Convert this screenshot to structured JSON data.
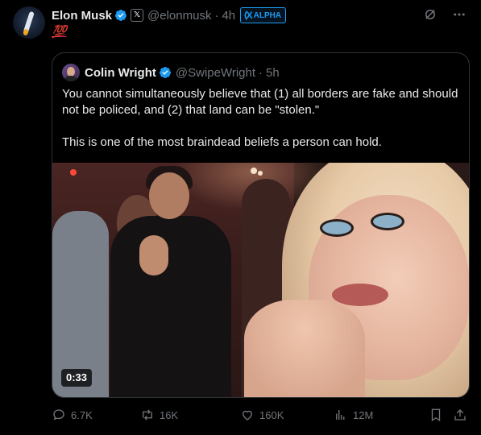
{
  "author": {
    "name": "Elon Musk",
    "handle": "@elonmusk",
    "time": "4h",
    "badge_label": "ALPHA",
    "badge_icon": "x-alpha-icon",
    "x_affiliation": "𝕏"
  },
  "tweet": {
    "text": "💯"
  },
  "quoted": {
    "name": "Colin Wright",
    "handle": "@SwipeWright",
    "time": "5h",
    "paragraphs": [
      "You cannot simultaneously believe that (1) all borders are fake and should not be policed, and (2) that land can be \"stolen.\"",
      "This is one of the most braindead beliefs a person can hold."
    ],
    "media": {
      "type": "video",
      "duration": "0:33"
    }
  },
  "actions": {
    "replies": "6.7K",
    "reposts": "16K",
    "likes": "160K",
    "views": "12M"
  },
  "colors": {
    "background": "#000000",
    "text": "#e7e9ea",
    "secondary": "#71767b",
    "verified": "#1d9bf0",
    "border": "#2f3336"
  }
}
